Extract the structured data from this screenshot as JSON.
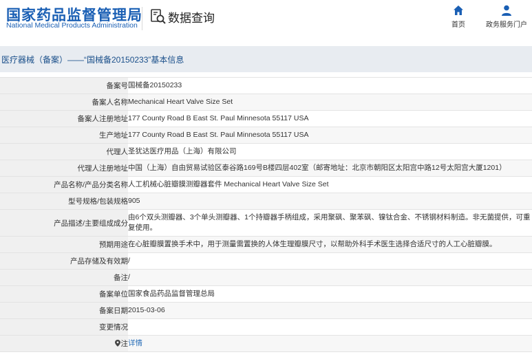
{
  "header": {
    "logo_cn": "国家药品监督管理局",
    "logo_en": "National Medical Products Administration",
    "query_title": "数据查询",
    "nav": [
      {
        "label": "首页",
        "icon": "home-icon"
      },
      {
        "label": "政务服务门户",
        "icon": "user-icon"
      }
    ]
  },
  "breadcrumb": "医疗器械（备案）——“国械备20150233”基本信息",
  "rows": [
    {
      "label": "备案号",
      "value": "国械备20150233"
    },
    {
      "label": "备案人名称",
      "value": "Mechanical Heart Valve Size Set"
    },
    {
      "label": "备案人注册地址",
      "value": "177 County Road B East St. Paul Minnesota 55117 USA"
    },
    {
      "label": "生产地址",
      "value": "177 County Road B East St. Paul Minnesota 55117 USA"
    },
    {
      "label": "代理人",
      "value": "圣犹达医疗用品（上海）有限公司"
    },
    {
      "label": "代理人注册地址",
      "value": "中国（上海）自由贸易试验区泰谷路169号B楼四层402室（邮寄地址：北京市朝阳区太阳宫中路12号太阳宫大厦1201）"
    },
    {
      "label": "产品名称/产品分类名称",
      "value": "人工机械心脏瓣膜测瓣器套件 Mechanical Heart Valve Size Set"
    },
    {
      "label": "型号规格/包装规格",
      "value": "905"
    },
    {
      "label": "产品描述/主要组成成分",
      "value": "由6个双头测瓣器、3个单头测瓣器、1个持瓣器手柄组成，采用聚砜、聚苯砜、镍钛合金、不锈钢材料制造。非无菌提供，可重复使用。"
    },
    {
      "label": "预期用途",
      "value": "在心脏瓣膜置换手术中，用于测量需置换的人体生理瓣膜尺寸，以帮助外科手术医生选择合适尺寸的人工心脏瓣膜。"
    },
    {
      "label": "产品存储及有效期",
      "value": "/"
    },
    {
      "label": "备注",
      "value": "/"
    },
    {
      "label": "备案单位",
      "value": "国家食品药品监督管理总局"
    },
    {
      "label": "备案日期",
      "value": "2015-03-06"
    },
    {
      "label": "变更情况",
      "value": ""
    },
    {
      "label": "注",
      "value": "详情",
      "icon": "location-pin-icon"
    }
  ],
  "colors": {
    "brand_blue": "#1a5fb4",
    "link_blue": "#2a6fb8"
  }
}
